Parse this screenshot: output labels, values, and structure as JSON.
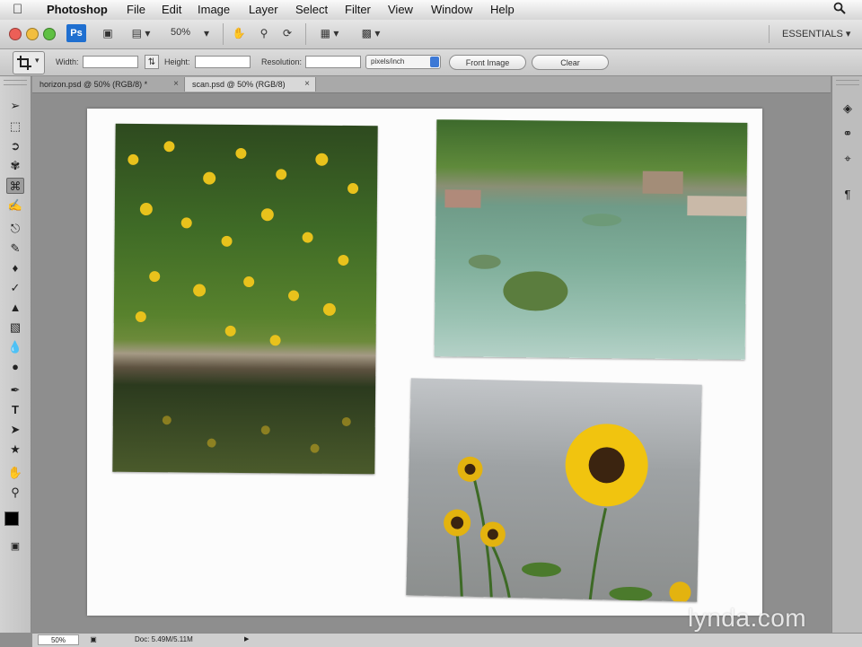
{
  "menubar": {
    "app_name": "Photoshop",
    "items": [
      "File",
      "Edit",
      "Image",
      "Layer",
      "Select",
      "Filter",
      "View",
      "Window",
      "Help"
    ]
  },
  "appbar": {
    "logo": "Ps",
    "zoom": "50%",
    "workspace": "ESSENTIALS"
  },
  "options": {
    "width_label": "Width:",
    "height_label": "Height:",
    "resolution_label": "Resolution:",
    "units": "pixels/inch",
    "front_image_label": "Front Image",
    "clear_label": "Clear"
  },
  "tabs": [
    {
      "label": "horizon.psd @ 50% (RGB/8) *",
      "close": "×",
      "active": false
    },
    {
      "label": "scan.psd @ 50% (RGB/8)",
      "close": "×",
      "active": true
    }
  ],
  "status": {
    "zoom": "50%",
    "doc": "Doc: 5.49M/5.11M"
  },
  "watermark": "lynda.com",
  "colors": {
    "accent": "#1f6fd0",
    "foreground_swatch": "#000000",
    "background_swatch": "#ffffff"
  },
  "icons": [
    "apple-icon",
    "spotlight-search-icon",
    "move-tool-icon",
    "marquee-tool-icon",
    "lasso-tool-icon",
    "quick-select-tool-icon",
    "crop-tool-icon",
    "eyedropper-tool-icon",
    "healing-brush-icon",
    "brush-tool-icon",
    "clone-stamp-icon",
    "history-brush-icon",
    "eraser-icon",
    "gradient-tool-icon",
    "blur-tool-icon",
    "dodge-tool-icon",
    "pen-tool-icon",
    "type-tool-icon",
    "path-select-icon",
    "shape-tool-icon",
    "hand-tool-icon",
    "zoom-tool-icon",
    "quick-mask-icon",
    "layers-panel-icon",
    "channels-panel-icon",
    "paths-panel-icon",
    "character-panel-icon"
  ]
}
